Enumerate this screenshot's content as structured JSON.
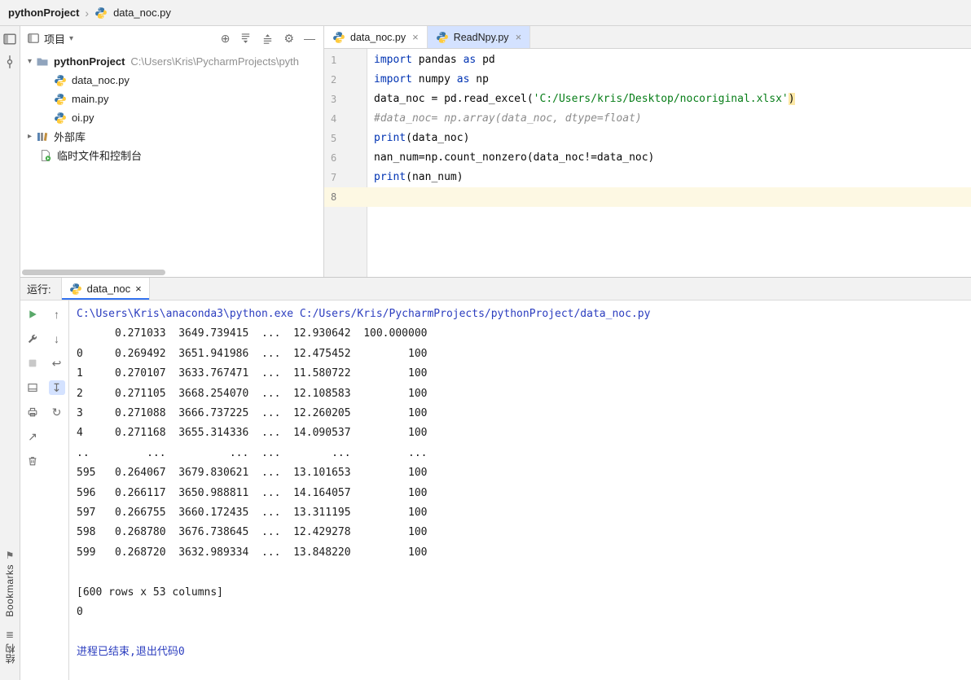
{
  "colors": {
    "keyword": "#0033b3",
    "string": "#067d17",
    "comment": "#8c8c8c",
    "plain": "#080808",
    "console_system": "#2b3dbf",
    "tab_selected": "#d4e2ff",
    "active_line": "#fdf8e3",
    "run_green": "#59a869",
    "brace_highlight": "#fce8a6"
  },
  "breadcrumb": {
    "project": "pythonProject",
    "separator": "›",
    "file": "data_noc.py"
  },
  "stripe": {
    "bookmarks": "Bookmarks",
    "structure": "结构"
  },
  "project_panel": {
    "title": "项目",
    "root_name": "pythonProject",
    "root_path": "C:\\Users\\Kris\\PycharmProjects\\pyth",
    "files": [
      "data_noc.py",
      "main.py",
      "oi.py"
    ],
    "external_libraries": "外部库",
    "scratches": "临时文件和控制台"
  },
  "editor": {
    "tabs": [
      {
        "label": "data_noc.py"
      },
      {
        "label": "ReadNpy.py"
      }
    ],
    "lines": [
      {
        "n": 1,
        "tokens": [
          {
            "t": "import"
          },
          {
            "t": " pandas "
          },
          {
            "t": "as"
          },
          {
            "t": " pd"
          }
        ]
      },
      {
        "n": 2,
        "tokens": [
          {
            "t": "import"
          },
          {
            "t": " numpy "
          },
          {
            "t": "as"
          },
          {
            "t": " np"
          }
        ]
      },
      {
        "n": 3,
        "tokens": [
          {
            "t": "data_noc = pd.read_excel("
          },
          {
            "t": "'C:/Users/kris/Desktop/nocoriginal.xlsx'"
          },
          {
            "t": ")"
          }
        ]
      },
      {
        "n": 4,
        "tokens": [
          {
            "t": "#data_noc= np.array(data_noc, dtype=float)"
          }
        ]
      },
      {
        "n": 5,
        "tokens": [
          {
            "t": "print"
          },
          {
            "t": "(data_noc)"
          }
        ]
      },
      {
        "n": 6,
        "tokens": [
          {
            "t": "nan_num=np.count_nonzero(data_noc!=data_noc)"
          }
        ]
      },
      {
        "n": 7,
        "tokens": [
          {
            "t": "print"
          },
          {
            "t": "(nan_num)"
          }
        ]
      },
      {
        "n": 8,
        "tokens": []
      }
    ]
  },
  "run": {
    "label": "运行:",
    "tab": "data_noc",
    "console": {
      "command": "C:\\Users\\Kris\\anaconda3\\python.exe C:/Users/Kris/PycharmProjects/pythonProject/data_noc.py",
      "output": "      0.271033  3649.739415  ...  12.930642  100.000000\n0     0.269492  3651.941986  ...  12.475452         100\n1     0.270107  3633.767471  ...  11.580722         100\n2     0.271105  3668.254070  ...  12.108583         100\n3     0.271088  3666.737225  ...  12.260205         100\n4     0.271168  3655.314336  ...  14.090537         100\n..         ...          ...  ...        ...         ...\n595   0.264067  3679.830621  ...  13.101653         100\n596   0.266117  3650.988811  ...  14.164057         100\n597   0.266755  3660.172435  ...  13.311195         100\n598   0.268780  3676.738645  ...  12.429278         100\n599   0.268720  3632.989334  ...  13.848220         100\n\n[600 rows x 53 columns]\n0",
      "exit": "进程已结束,退出代码0"
    }
  },
  "icons": {
    "chevron_down": "▾",
    "chevron_right": "▸",
    "close": "×",
    "locate": "⊕",
    "settings_gear": "⚙",
    "hide": "—",
    "up_arrow": "↑",
    "down_arrow": "↓",
    "rerun_arrow": "↻",
    "soft_wrap": "↩",
    "scroll_end": "↧",
    "pin": "↗",
    "bookmark": "⚑",
    "structure": "≣"
  }
}
